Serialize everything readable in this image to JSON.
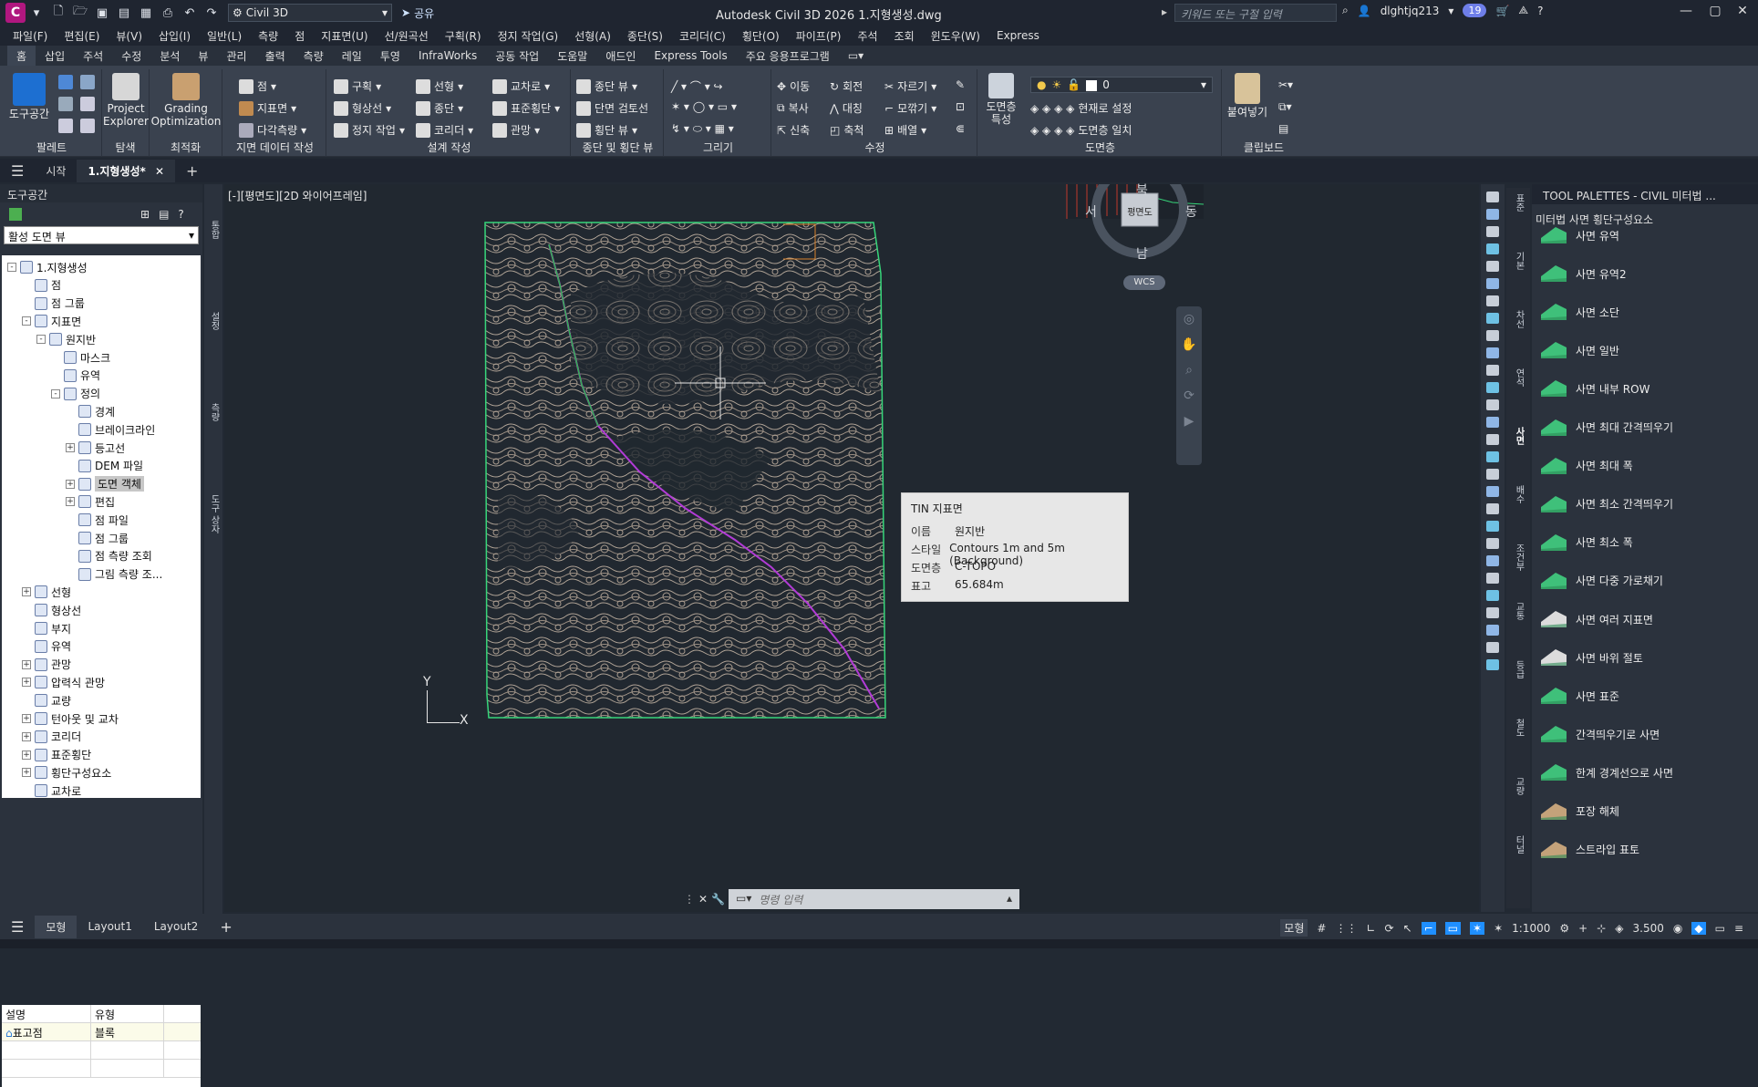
{
  "titlebar": {
    "logo": "C",
    "workspace": "Civil 3D",
    "share": "공유",
    "title": "Autodesk Civil 3D 2026    1.지형생성.dwg",
    "search_placeholder": "키워드 또는 구절 입력",
    "user": "dlghtjq213",
    "notifications": "19"
  },
  "menubar": [
    "파일(F)",
    "편집(E)",
    "뷰(V)",
    "삽입(I)",
    "일반(L)",
    "측량",
    "점",
    "지표면(U)",
    "선/원곡선",
    "구획(R)",
    "정지 작업(G)",
    "선형(A)",
    "종단(S)",
    "코리더(C)",
    "횡단(O)",
    "파이프(P)",
    "주석",
    "조회",
    "윈도우(W)",
    "Express"
  ],
  "ribbon_tabs": [
    "홈",
    "삽입",
    "주석",
    "수정",
    "분석",
    "뷰",
    "관리",
    "출력",
    "측량",
    "레일",
    "투영",
    "InfraWorks",
    "공동 작업",
    "도움말",
    "애드인",
    "Express Tools",
    "주요 응용프로그램"
  ],
  "ribbon": {
    "palette_panel": {
      "toolspace": "도구공간",
      "title": "팔레트"
    },
    "explore_panel": {
      "project_explorer_1": "Project",
      "project_explorer_2": "Explorer",
      "title": "탐색"
    },
    "optimize_panel": {
      "grading_1": "Grading",
      "grading_2": "Optimization",
      "title": "최적화"
    },
    "ground_panel": {
      "points": "점",
      "surfaces": "지표면",
      "traverse": "다각측량",
      "title": "지면 데이터 작성"
    },
    "design_panel": {
      "parcel": "구획",
      "feature_line": "형상선",
      "grading": "정지 작업",
      "alignment": "선형",
      "profile": "종단",
      "corridor": "코리더",
      "intersection": "교차로",
      "assembly": "표준횡단",
      "pipe": "관망",
      "title": "설계 작성"
    },
    "profile_panel": {
      "profile_view": "종단 뷰",
      "section_review": "단면 검토선",
      "section_view": "횡단 뷰",
      "title": "종단 및 횡단 뷰"
    },
    "draw_panel": {
      "title": "그리기"
    },
    "modify_panel": {
      "move": "이동",
      "rotate": "회전",
      "trim": "자르기",
      "copy": "복사",
      "mirror": "대칭",
      "fillet": "모깎기",
      "stretch": "신축",
      "scale": "축척",
      "array": "배열",
      "title": "수정"
    },
    "layer_panel": {
      "layer_props_1": "도면층",
      "layer_props_2": "특성",
      "current_layer": "0",
      "make_current": "현재로 설정",
      "match": "도면층 일치",
      "title": "도면층"
    },
    "clipboard_panel": {
      "paste": "붙여넣기",
      "title": "클립보드"
    }
  },
  "doctabs": [
    "시작",
    "1.지형생성*"
  ],
  "toolspace": {
    "header": "도구공간",
    "view": "활성 도면 뷰",
    "tree": [
      {
        "label": "1.지형생성",
        "level": 0,
        "exp": "-"
      },
      {
        "label": "점",
        "level": 1,
        "exp": ""
      },
      {
        "label": "점 그룹",
        "level": 1,
        "exp": ""
      },
      {
        "label": "지표면",
        "level": 1,
        "exp": "-"
      },
      {
        "label": "원지반",
        "level": 2,
        "exp": "-"
      },
      {
        "label": "마스크",
        "level": 3,
        "exp": ""
      },
      {
        "label": "유역",
        "level": 3,
        "exp": ""
      },
      {
        "label": "정의",
        "level": 3,
        "exp": "-"
      },
      {
        "label": "경계",
        "level": 4,
        "exp": ""
      },
      {
        "label": "브레이크라인",
        "level": 4,
        "exp": ""
      },
      {
        "label": "등고선",
        "level": 4,
        "exp": "+"
      },
      {
        "label": "DEM 파일",
        "level": 4,
        "exp": ""
      },
      {
        "label": "도면 객체",
        "level": 4,
        "exp": "+",
        "selected": true
      },
      {
        "label": "편집",
        "level": 4,
        "exp": "+"
      },
      {
        "label": "점 파일",
        "level": 4,
        "exp": ""
      },
      {
        "label": "점 그룹",
        "level": 4,
        "exp": ""
      },
      {
        "label": "점 측량 조회",
        "level": 4,
        "exp": ""
      },
      {
        "label": "그림 측량 조...",
        "level": 4,
        "exp": ""
      },
      {
        "label": "선형",
        "level": 1,
        "exp": "+"
      },
      {
        "label": "형상선",
        "level": 1,
        "exp": ""
      },
      {
        "label": "부지",
        "level": 1,
        "exp": ""
      },
      {
        "label": "유역",
        "level": 1,
        "exp": ""
      },
      {
        "label": "관망",
        "level": 1,
        "exp": "+"
      },
      {
        "label": "압력식 관망",
        "level": 1,
        "exp": "+"
      },
      {
        "label": "교량",
        "level": 1,
        "exp": ""
      },
      {
        "label": "턴아웃 및 교차",
        "level": 1,
        "exp": "+"
      },
      {
        "label": "코리더",
        "level": 1,
        "exp": "+"
      },
      {
        "label": "표준횡단",
        "level": 1,
        "exp": "+"
      },
      {
        "label": "횡단구성요소",
        "level": 1,
        "exp": "+"
      },
      {
        "label": "교차로",
        "level": 1,
        "exp": ""
      }
    ],
    "vtabs": [
      "통합",
      "설정",
      "측량",
      "도구 상자"
    ],
    "grid_headers": [
      "설명",
      "유형"
    ],
    "grid_rows": [
      [
        "표고점",
        "블록"
      ]
    ]
  },
  "drawing": {
    "viewport_label": "[-][평면도][2D 와이어프레임]",
    "viewcube": {
      "north": "북",
      "south": "남",
      "east": "동",
      "west": "서",
      "face": "평면도",
      "wcs": "WCS"
    },
    "ucs_y": "Y",
    "ucs_x": "X"
  },
  "tooltip": {
    "title": "TIN 지표면",
    "rows": [
      {
        "k": "이름",
        "v": "원지반"
      },
      {
        "k": "스타일",
        "v": "Contours 1m and 5m (Background)"
      },
      {
        "k": "도면층",
        "v": "C-TOPO"
      },
      {
        "k": "표고",
        "v": "65.684m"
      }
    ]
  },
  "command_line": {
    "placeholder": "명령 입력"
  },
  "palette": {
    "header": "TOOL PALETTES - CIVIL 미터법 ...",
    "subtitle": "미터법 사면 횡단구성요소",
    "tabs": [
      "표준",
      "기본",
      "차선",
      "연석",
      "사면",
      "배수",
      "조건부",
      "교통",
      "등급",
      "철도",
      "교량",
      "터널"
    ],
    "items": [
      "사면 유역",
      "사면 유역2",
      "사면 소단",
      "사면 일반",
      "사면 내부 ROW",
      "사면 최대 간격띄우기",
      "사면 최대 폭",
      "사면 최소 간격띄우기",
      "사면 최소 폭",
      "사면 다중 가로채기",
      "사면 여러 지표면",
      "사면 바위 절토",
      "사면 표준",
      "간격띄우기로 사면",
      "한계 경계선으로 사면",
      "포장 해체",
      "스트라입 표토"
    ]
  },
  "statusbar": {
    "tabs": [
      "모형",
      "Layout1",
      "Layout2"
    ],
    "model": "모형",
    "scale": "1:1000",
    "annotation": "3.500"
  },
  "colors": {
    "accent": "#1f8fff",
    "boundary": "#37d67a",
    "contour": "#b6a89a",
    "alignment": "#b23bd6",
    "logo": "#b0177f"
  }
}
